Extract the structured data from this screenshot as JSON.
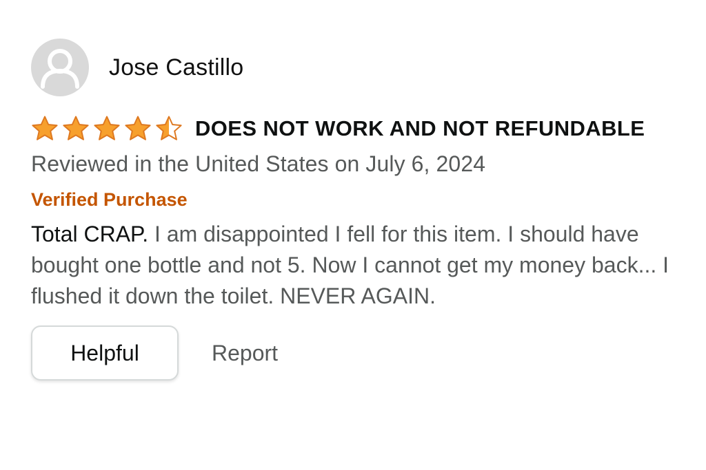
{
  "review": {
    "author": "Jose Castillo",
    "rating": 4.5,
    "rating_max": 5,
    "title": "DOES NOT WORK AND NOT REFUNDABLE",
    "date_line": "Reviewed in the United States on July 6, 2024",
    "verified_label": "Verified Purchase",
    "body_lead": "Total CRAP.",
    "body_rest": " I am disappointed I fell for this item. I should have bought one bottle and not 5. Now I cannot get my money back... I flushed it down the toilet. NEVER AGAIN."
  },
  "actions": {
    "helpful_label": "Helpful",
    "report_label": "Report"
  },
  "icons": {
    "avatar": "user-silhouette-icon",
    "star_full": "star-filled-icon",
    "star_half": "star-half-icon"
  },
  "colors": {
    "star_fill": "#f7a02d",
    "star_stroke": "#de7921",
    "verified": "#c45500",
    "muted_text": "#565959",
    "primary_text": "#0f1111",
    "avatar_bg": "#d9d9d9"
  }
}
